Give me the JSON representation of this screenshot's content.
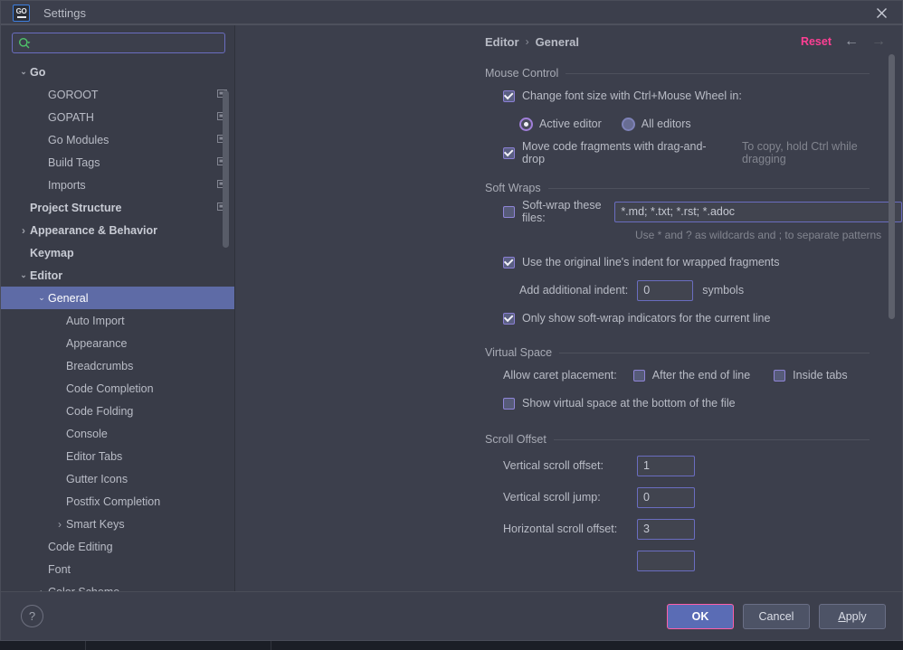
{
  "window": {
    "title": "Settings",
    "app_icon": "go-logo-icon",
    "close_icon": "close-icon"
  },
  "search": {
    "value": "",
    "placeholder": "",
    "icon": "search-icon"
  },
  "sidebar": {
    "items": [
      {
        "label": "Go",
        "depth": 0,
        "arrow": "expanded",
        "bold": true,
        "module_icon": false,
        "selected": false
      },
      {
        "label": "GOROOT",
        "depth": 1,
        "arrow": "none",
        "bold": false,
        "module_icon": true,
        "selected": false
      },
      {
        "label": "GOPATH",
        "depth": 1,
        "arrow": "none",
        "bold": false,
        "module_icon": true,
        "selected": false
      },
      {
        "label": "Go Modules",
        "depth": 1,
        "arrow": "none",
        "bold": false,
        "module_icon": true,
        "selected": false
      },
      {
        "label": "Build Tags",
        "depth": 1,
        "arrow": "none",
        "bold": false,
        "module_icon": true,
        "selected": false
      },
      {
        "label": "Imports",
        "depth": 1,
        "arrow": "none",
        "bold": false,
        "module_icon": true,
        "selected": false
      },
      {
        "label": "Project Structure",
        "depth": 0,
        "arrow": "none",
        "bold": true,
        "module_icon": true,
        "selected": false
      },
      {
        "label": "Appearance & Behavior",
        "depth": 0,
        "arrow": "collapsed",
        "bold": true,
        "module_icon": false,
        "selected": false
      },
      {
        "label": "Keymap",
        "depth": 0,
        "arrow": "none",
        "bold": true,
        "module_icon": false,
        "selected": false
      },
      {
        "label": "Editor",
        "depth": 0,
        "arrow": "expanded",
        "bold": true,
        "module_icon": false,
        "selected": false
      },
      {
        "label": "General",
        "depth": 1,
        "arrow": "expanded",
        "bold": false,
        "module_icon": false,
        "selected": true
      },
      {
        "label": "Auto Import",
        "depth": 2,
        "arrow": "none",
        "bold": false,
        "module_icon": false,
        "selected": false
      },
      {
        "label": "Appearance",
        "depth": 2,
        "arrow": "none",
        "bold": false,
        "module_icon": false,
        "selected": false
      },
      {
        "label": "Breadcrumbs",
        "depth": 2,
        "arrow": "none",
        "bold": false,
        "module_icon": false,
        "selected": false
      },
      {
        "label": "Code Completion",
        "depth": 2,
        "arrow": "none",
        "bold": false,
        "module_icon": false,
        "selected": false
      },
      {
        "label": "Code Folding",
        "depth": 2,
        "arrow": "none",
        "bold": false,
        "module_icon": false,
        "selected": false
      },
      {
        "label": "Console",
        "depth": 2,
        "arrow": "none",
        "bold": false,
        "module_icon": false,
        "selected": false
      },
      {
        "label": "Editor Tabs",
        "depth": 2,
        "arrow": "none",
        "bold": false,
        "module_icon": false,
        "selected": false
      },
      {
        "label": "Gutter Icons",
        "depth": 2,
        "arrow": "none",
        "bold": false,
        "module_icon": false,
        "selected": false
      },
      {
        "label": "Postfix Completion",
        "depth": 2,
        "arrow": "none",
        "bold": false,
        "module_icon": false,
        "selected": false
      },
      {
        "label": "Smart Keys",
        "depth": 2,
        "arrow": "collapsed",
        "bold": false,
        "module_icon": false,
        "selected": false
      },
      {
        "label": "Code Editing",
        "depth": 1,
        "arrow": "none",
        "bold": false,
        "module_icon": false,
        "selected": false
      },
      {
        "label": "Font",
        "depth": 1,
        "arrow": "none",
        "bold": false,
        "module_icon": false,
        "selected": false
      },
      {
        "label": "Color Scheme",
        "depth": 1,
        "arrow": "collapsed",
        "bold": false,
        "module_icon": false,
        "selected": false
      }
    ]
  },
  "breadcrumb": {
    "parent": "Editor",
    "separator": "›",
    "current": "General",
    "reset_label": "Reset",
    "back_icon": "arrow-left-icon",
    "forward_icon": "arrow-right-icon"
  },
  "sections": {
    "mouse_control": {
      "title": "Mouse Control",
      "change_font_size": {
        "label": "Change font size with Ctrl+Mouse Wheel in:",
        "checked": true
      },
      "scope_options": [
        {
          "label": "Active editor",
          "selected": true
        },
        {
          "label": "All editors",
          "selected": false
        }
      ],
      "move_code_fragments": {
        "label": "Move code fragments with drag-and-drop",
        "checked": true
      },
      "move_code_hint": "To copy, hold Ctrl while dragging"
    },
    "soft_wraps": {
      "title": "Soft Wraps",
      "soft_wrap_files": {
        "label": "Soft-wrap these files:",
        "checked": false,
        "value": "*.md; *.txt; *.rst; *.adoc"
      },
      "wildcard_hint": "Use * and ? as wildcards and ; to separate patterns",
      "use_original_indent": {
        "label": "Use the original line's indent for wrapped fragments",
        "checked": true
      },
      "additional_indent": {
        "label": "Add additional indent:",
        "value": "0",
        "suffix": "symbols"
      },
      "only_show_indicators": {
        "label": "Only show soft-wrap indicators for the current line",
        "checked": true
      }
    },
    "virtual_space": {
      "title": "Virtual Space",
      "caret_placement_label": "Allow caret placement:",
      "caret_options": [
        {
          "label": "After the end of line",
          "checked": false
        },
        {
          "label": "Inside tabs",
          "checked": false
        }
      ],
      "show_virtual_space": {
        "label": "Show virtual space at the bottom of the file",
        "checked": false
      }
    },
    "scroll_offset": {
      "title": "Scroll Offset",
      "fields": [
        {
          "label": "Vertical scroll offset:",
          "value": "1"
        },
        {
          "label": "Vertical scroll jump:",
          "value": "0"
        },
        {
          "label": "Horizontal scroll offset:",
          "value": "3"
        }
      ]
    }
  },
  "footer": {
    "help_label": "?",
    "ok_label": "OK",
    "cancel_label": "Cancel",
    "apply_label_prefix": "A",
    "apply_label_rest": "pply"
  },
  "colors": {
    "accent_pink": "#ff3f94",
    "selection_blue": "#5e6ba6",
    "checkbox_purple": "#8a7fd4",
    "dialog_bg": "#3c3f4c",
    "sidebar_bg": "#393c48"
  }
}
